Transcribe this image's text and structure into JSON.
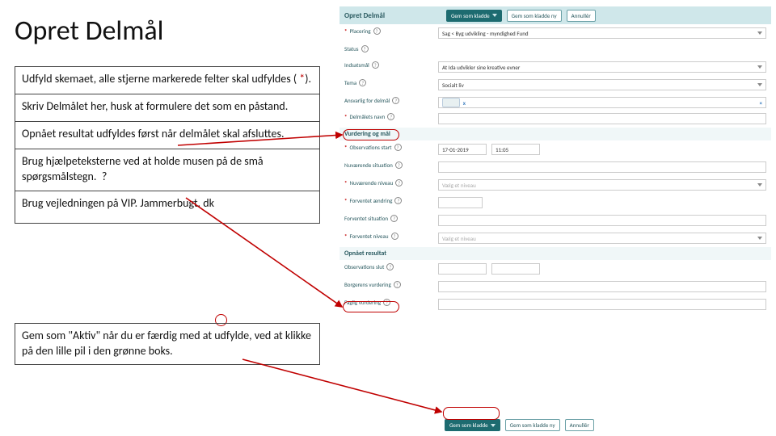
{
  "slide": {
    "title": "Opret Delmål",
    "instructions": {
      "p1a": "Udfyld skemaet, alle stjerne markerede felter skal udfyldes ( ",
      "p1_star": "*",
      "p1b": ").",
      "p2": "Skriv Delmålet her, husk at formulere det som en påstand.",
      "p3": "Opnået resultat udfyldes først når delmålet skal afsluttes.",
      "p4": "Brug hjælpeteksterne ved at holde musen på de små spørgsmålstegn.",
      "p4_icon": "?",
      "p5": "Brug vejledningen på VIP. Jammerbugt. dk",
      "p6": "Gem som \"Aktiv\" når du er færdig med at udfylde, ved at klikke på den lille pil i den grønne boks."
    }
  },
  "form": {
    "header_title": "Opret Delmål",
    "btn_save_draft": "Gem som kladde",
    "btn_save_draft_new": "Gem som kladde ny",
    "btn_cancel": "Annullér",
    "help_glyph": "?",
    "rows": {
      "placering": {
        "label": "Placering",
        "value": "Sag < Byg udvikling - myndighed Fund"
      },
      "status": {
        "label": "Status"
      },
      "indsatsmaal": {
        "label": "Indsatsmål",
        "value": "At Ida udvikler sine kreative evner"
      },
      "tema": {
        "label": "Tema",
        "value": "Socialt liv"
      },
      "ansvarlig": {
        "label": "Ansvarlig for delmål",
        "tag": "x"
      },
      "delmaal_navn": {
        "label": "Delmålets navn"
      },
      "vurdering_hdr": "Vurdering og mål",
      "obs_start": {
        "label": "Observations start",
        "date": "17-01-2019",
        "time": "11:05"
      },
      "nuv_situation": {
        "label": "Nuværende situation"
      },
      "nuv_niveau": {
        "label": "Nuværende niveau",
        "placeholder": "Vælg et niveau"
      },
      "forventet": {
        "label": "Forventet ændring"
      },
      "forventet_sit": {
        "label": "Forventet situation"
      },
      "forventet_niv": {
        "label": "Forventet niveau",
        "placeholder": "Vælg et niveau"
      },
      "opnaaet_hdr": "Opnået resultat",
      "obs_slut": {
        "label": "Observations slut"
      },
      "borger_vurd": {
        "label": "Borgerens vurdering"
      },
      "faglig_vurd": {
        "label": "Faglig vurdering"
      }
    }
  }
}
